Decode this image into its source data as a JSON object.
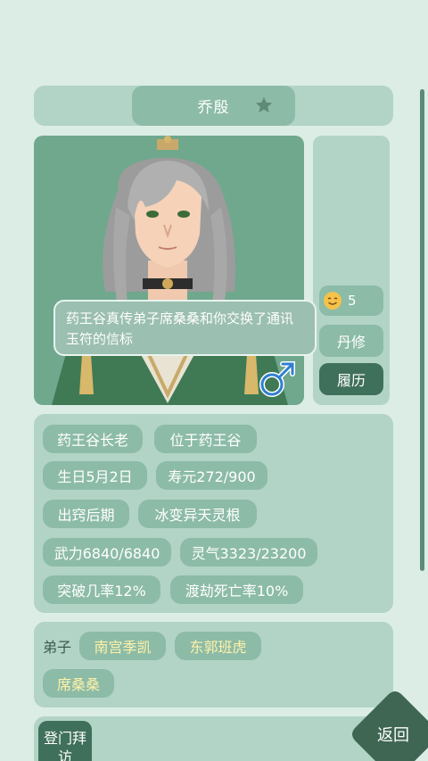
{
  "header": {
    "name": "乔殷",
    "favorite_icon": "star-icon"
  },
  "portrait": {
    "speech": "药王谷真传弟子席桑桑和你交换了通讯玉符的信标",
    "gender_icon": "male-icon"
  },
  "side": {
    "mood_icon": "smiley-icon",
    "mood_value": "5",
    "danxiu_label": "丹修",
    "lvli_label": "履历"
  },
  "info_tags": [
    "药王谷长老",
    "位于药王谷",
    "生日5月2日",
    "寿元272/900",
    "出窍后期",
    "冰变异天灵根",
    "武力6840/6840",
    "灵气3323/23200",
    "突破几率12%",
    "渡劫死亡率10%"
  ],
  "disciples": {
    "label": "弟子",
    "names": [
      "南宫季凯",
      "东郭班虎",
      "席桑桑"
    ]
  },
  "actions": {
    "visit_label": "登门拜访",
    "back_label": "返回"
  },
  "colors": {
    "background": "#dcede6",
    "panel": "#b2d4c6",
    "tag": "#8cbba7",
    "dark_button": "#3f705b",
    "gold_text": "#fff2a8",
    "gender_blue": "#2f7fd0"
  }
}
